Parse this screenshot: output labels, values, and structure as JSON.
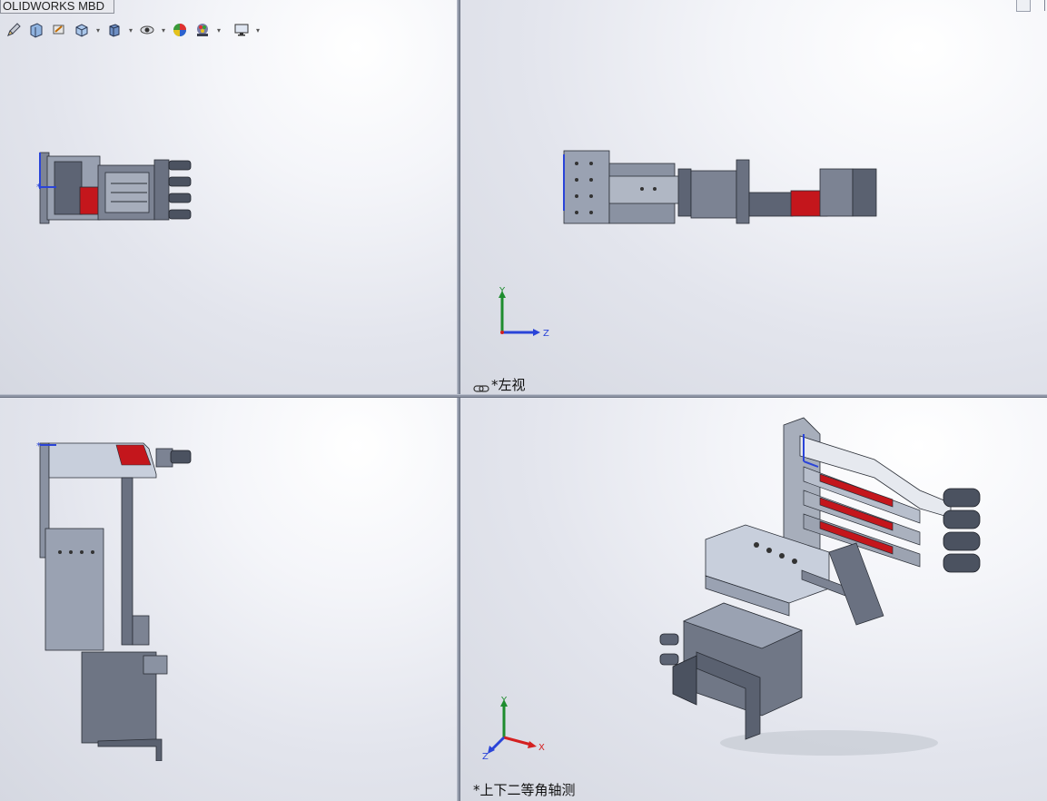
{
  "tab": {
    "label": "OLIDWORKS MBD"
  },
  "toolbar": {
    "icons": [
      "pencil-icon",
      "section-view-icon",
      "dynamic-annotation-icon",
      "view-orientation-icon",
      "display-style-icon",
      "hide-show-icon",
      "appearance-icon",
      "scene-icon",
      "display-settings-icon"
    ]
  },
  "views": {
    "top_right": {
      "label": "*左视",
      "triad": [
        "Y",
        "Z"
      ]
    },
    "bottom_right": {
      "label": "*上下二等角轴测",
      "triad": [
        "Y",
        "X",
        "Z"
      ]
    }
  },
  "colors": {
    "axis_y": "#1e8c2e",
    "axis_z": "#2a44d8",
    "axis_x": "#d42020",
    "part_steel": "#9aa2b2",
    "part_dark": "#4b5260",
    "part_red": "#c4161c"
  }
}
